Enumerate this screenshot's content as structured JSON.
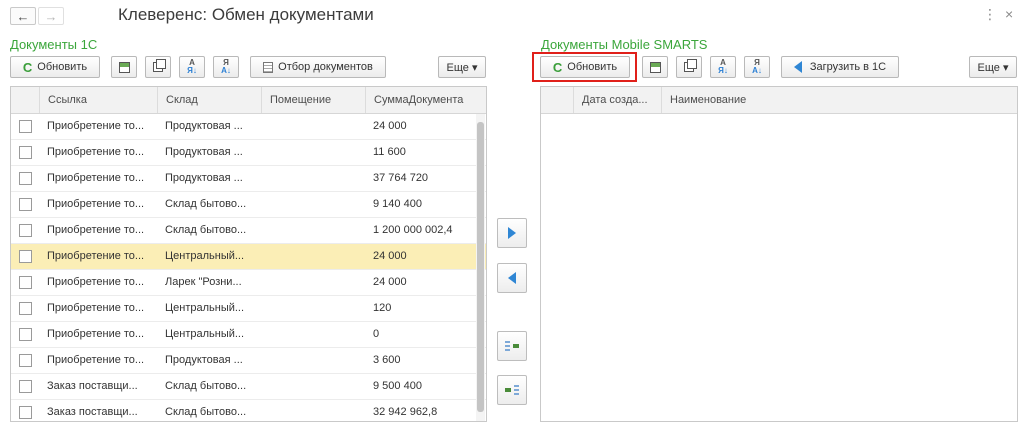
{
  "window": {
    "title": "Клеверенс: Обмен документами",
    "back_icon": "←",
    "forward_icon": "→",
    "menu_icon": "⋮",
    "close_icon": "×"
  },
  "left_panel": {
    "title": "Документы 1С",
    "toolbar": {
      "refresh_label": "Обновить",
      "filter_label": "Отбор документов",
      "more_label": "Еще ▾"
    },
    "columns": [
      "Ссылка",
      "Склад",
      "Помещение",
      "СуммаДокумента"
    ],
    "rows": [
      {
        "link": "Приобретение то...",
        "warehouse": "Продуктовая ...",
        "room": "",
        "sum": "24 000"
      },
      {
        "link": "Приобретение то...",
        "warehouse": "Продуктовая ...",
        "room": "",
        "sum": "11 600"
      },
      {
        "link": "Приобретение то...",
        "warehouse": "Продуктовая ...",
        "room": "",
        "sum": "37 764 720"
      },
      {
        "link": "Приобретение то...",
        "warehouse": "Склад бытово...",
        "room": "",
        "sum": "9 140 400"
      },
      {
        "link": "Приобретение то...",
        "warehouse": "Склад бытово...",
        "room": "",
        "sum": "1 200 000 002,4"
      },
      {
        "link": "Приобретение то...",
        "warehouse": "Центральный...",
        "room": "",
        "sum": "24 000",
        "selected": true
      },
      {
        "link": "Приобретение то...",
        "warehouse": "Ларек \"Розни...",
        "room": "",
        "sum": "24 000"
      },
      {
        "link": "Приобретение то...",
        "warehouse": "Центральный...",
        "room": "",
        "sum": "120"
      },
      {
        "link": "Приобретение то...",
        "warehouse": "Центральный...",
        "room": "",
        "sum": "0"
      },
      {
        "link": "Приобретение то...",
        "warehouse": "Продуктовая ...",
        "room": "",
        "sum": "3 600"
      },
      {
        "link": "Заказ поставщи...",
        "warehouse": "Склад бытово...",
        "room": "",
        "sum": "9 500 400"
      },
      {
        "link": "Заказ поставщи...",
        "warehouse": "Склад бытово...",
        "room": "",
        "sum": "32 942 962,8"
      }
    ]
  },
  "right_panel": {
    "title": "Документы Mobile SMARTS",
    "toolbar": {
      "refresh_label": "Обновить",
      "load_label": "Загрузить в 1С",
      "more_label": "Еще ▾"
    },
    "columns": [
      "Дата созда...",
      "Наименование"
    ],
    "rows": []
  },
  "colors": {
    "section_title": "#3ba63b",
    "highlight": "#e0201a",
    "selected_row": "#fbeeb6",
    "arrow": "#2f86d4"
  }
}
